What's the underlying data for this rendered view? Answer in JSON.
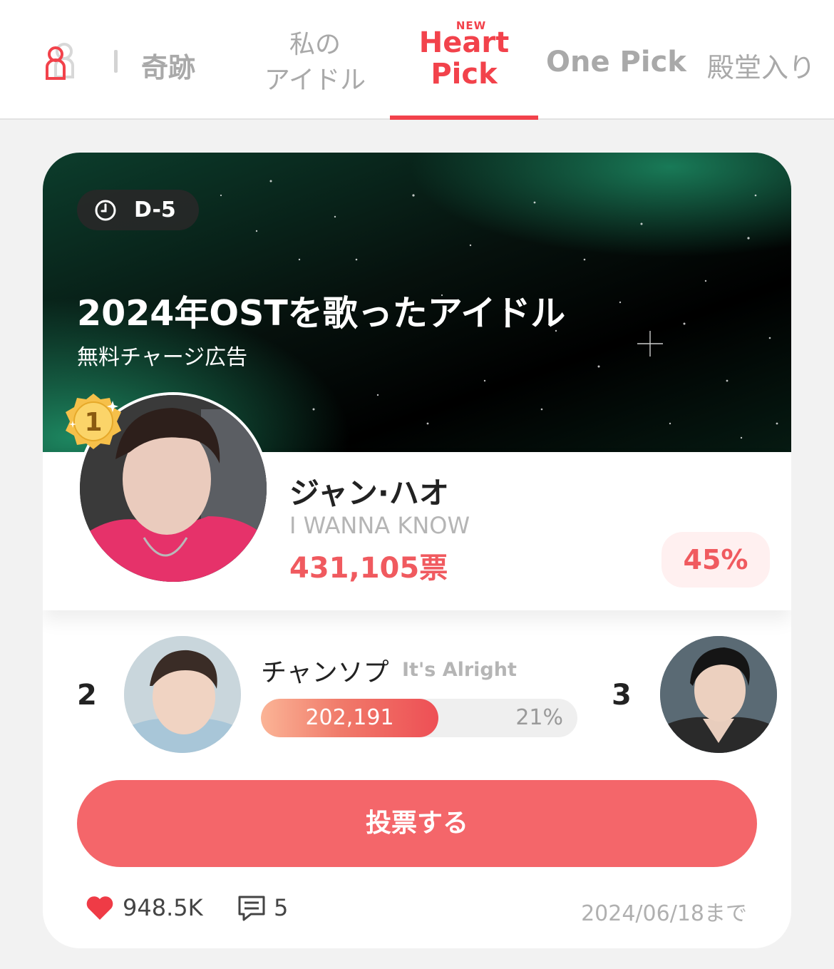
{
  "nav": {
    "tabs": [
      {
        "label": "奇跡"
      },
      {
        "label_line1": "私の",
        "label_line2": "アイドル"
      },
      {
        "badge": "NEW",
        "label_line1": "Heart",
        "label_line2": "Pick",
        "active": true
      },
      {
        "label": "One Pick"
      },
      {
        "label": "殿堂入り"
      }
    ],
    "accent_color": "#f2424b"
  },
  "card": {
    "dday": "D-5",
    "title": "2024年OSTを歌ったアイドル",
    "subtitle": "無料チャージ広告",
    "rank1": {
      "rank": "1",
      "name": "ジャン·ハオ",
      "song": "I WANNA KNOW",
      "votes": "431,105票",
      "percent": "45%"
    },
    "rank2": {
      "rank": "2",
      "name": "チャンソプ",
      "song": "It's Alright",
      "votes": "202,191",
      "percent": "21%",
      "share": 0.56
    },
    "rank3": {
      "rank": "3"
    },
    "vote_button": "投票する",
    "likes": "948.5K",
    "comments": "5",
    "deadline": "2024/06/18まで"
  }
}
